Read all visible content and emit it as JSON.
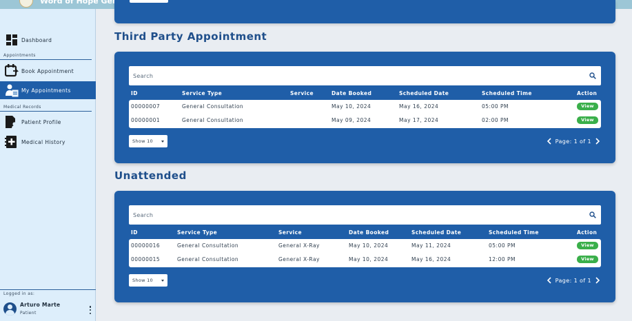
{
  "header": {
    "hospital_name": "Word of Hope General Hospital"
  },
  "sidebar": {
    "items": [
      {
        "label": "Dashboard",
        "icon": "dashboard-icon"
      },
      {
        "label": "Book Appointment",
        "icon": "calendar-icon"
      },
      {
        "label": "My Appointments",
        "icon": "appointments-icon",
        "active": true
      },
      {
        "label": "Patient Profile",
        "icon": "patient-profile-icon"
      },
      {
        "label": "Medical History",
        "icon": "medical-history-icon"
      }
    ],
    "sections": {
      "appointments": "Appointments",
      "medical_records": "Medical Records"
    },
    "logged_in_label": "Logged in as:",
    "user": {
      "name": "Arturo Marte",
      "role": "Patient"
    }
  },
  "colors": {
    "primary": "#1f5ea8",
    "accent_green": "#3aaf4a",
    "sidebar_bg": "#ddeefb",
    "topbar": "#9cc6d6"
  },
  "third_party": {
    "title": "Third Party Appointment",
    "search_placeholder": "Search",
    "columns": [
      "ID",
      "Service Type",
      "Service",
      "Date Booked",
      "Scheduled Date",
      "Scheduled Time",
      "Action"
    ],
    "rows": [
      {
        "id": "00000007",
        "service_type": "General Consultation",
        "service": "",
        "date_booked": "May 10, 2024",
        "scheduled_date": "May 16, 2024",
        "scheduled_time": "05:00 PM",
        "action": "View"
      },
      {
        "id": "00000001",
        "service_type": "General Consultation",
        "service": "",
        "date_booked": "May 09, 2024",
        "scheduled_date": "May 17, 2024",
        "scheduled_time": "02:00 PM",
        "action": "View"
      }
    ],
    "show": "Show 10",
    "page": "Page: 1 of 1"
  },
  "unattended": {
    "title": "Unattended",
    "search_placeholder": "Search",
    "columns": [
      "ID",
      "Service Type",
      "Service",
      "Date Booked",
      "Scheduled Date",
      "Scheduled Time",
      "Action"
    ],
    "rows": [
      {
        "id": "00000016",
        "service_type": "General Consultation",
        "service": "General X-Ray",
        "date_booked": "May 10, 2024",
        "scheduled_date": "May 11, 2024",
        "scheduled_time": "05:00 PM",
        "action": "View"
      },
      {
        "id": "00000015",
        "service_type": "General Consultation",
        "service": "General X-Ray",
        "date_booked": "May 10, 2024",
        "scheduled_date": "May 16, 2024",
        "scheduled_time": "12:00 PM",
        "action": "View"
      }
    ],
    "show": "Show 10",
    "page": "Page: 1 of 1"
  }
}
